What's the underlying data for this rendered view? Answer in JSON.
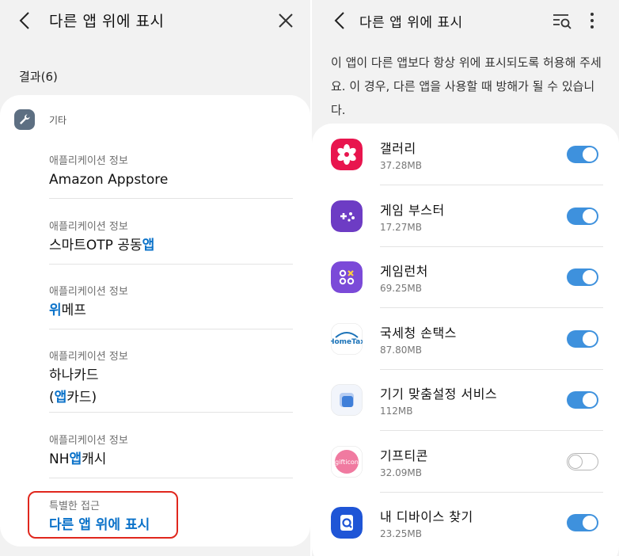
{
  "left": {
    "title": "다른 앱 위에 표시",
    "results_label": "결과(6)",
    "category": {
      "label": "기타",
      "icon": "wrench-icon"
    },
    "results": [
      {
        "sub": "애플리케이션 정보",
        "parts": [
          {
            "t": "Amazon Appstore",
            "h": false
          }
        ]
      },
      {
        "sub": "애플리케이션 정보",
        "parts": [
          {
            "t": "스마트OTP 공동",
            "h": false
          },
          {
            "t": "앱",
            "h": true
          }
        ]
      },
      {
        "sub": "애플리케이션 정보",
        "parts": [
          {
            "t": "위",
            "h": true
          },
          {
            "t": "메프",
            "h": false
          }
        ]
      },
      {
        "sub": "애플리케이션 정보",
        "parts": [
          {
            "t": "하나카드",
            "h": false
          }
        ],
        "line2": [
          {
            "t": "(",
            "h": false
          },
          {
            "t": "앱",
            "h": true
          },
          {
            "t": "카드)",
            "h": false
          }
        ]
      },
      {
        "sub": "애플리케이션 정보",
        "parts": [
          {
            "t": "NH",
            "h": false
          },
          {
            "t": "앱",
            "h": true
          },
          {
            "t": "캐시",
            "h": false
          }
        ]
      }
    ],
    "special": {
      "sub": "특별한 접근",
      "main": "다른 앱 위에 표시"
    }
  },
  "right": {
    "title": "다른 앱 위에 표시",
    "description": "이 앱이 다른 앱보다 항상 위에 표시되도록 허용해 주세요. 이 경우, 다른 앱을 사용할 때 방해가 될 수 있습니다.",
    "apps": [
      {
        "name": "갤러리",
        "size": "37.28MB",
        "enabled": true,
        "icon": "gallery-icon"
      },
      {
        "name": "게임 부스터",
        "size": "17.27MB",
        "enabled": true,
        "icon": "game-booster-icon"
      },
      {
        "name": "게임런처",
        "size": "69.25MB",
        "enabled": true,
        "icon": "game-launcher-icon"
      },
      {
        "name": "국세청 손택스",
        "size": "87.80MB",
        "enabled": true,
        "icon": "hometax-icon"
      },
      {
        "name": "기기 맞춤설정 서비스",
        "size": "112MB",
        "enabled": true,
        "icon": "customization-service-icon"
      },
      {
        "name": "기프티콘",
        "size": "32.09MB",
        "enabled": false,
        "icon": "gifticon-icon"
      },
      {
        "name": "내 디바이스 찾기",
        "size": "23.25MB",
        "enabled": true,
        "icon": "find-my-device-icon"
      }
    ],
    "icon_texts": {
      "hometax": "HomeTax",
      "gifticon": "gifticon"
    }
  },
  "colors": {
    "accent": "#0b72c9",
    "toggle_on": "#3e91dd",
    "highlight_border": "#e0271d"
  }
}
